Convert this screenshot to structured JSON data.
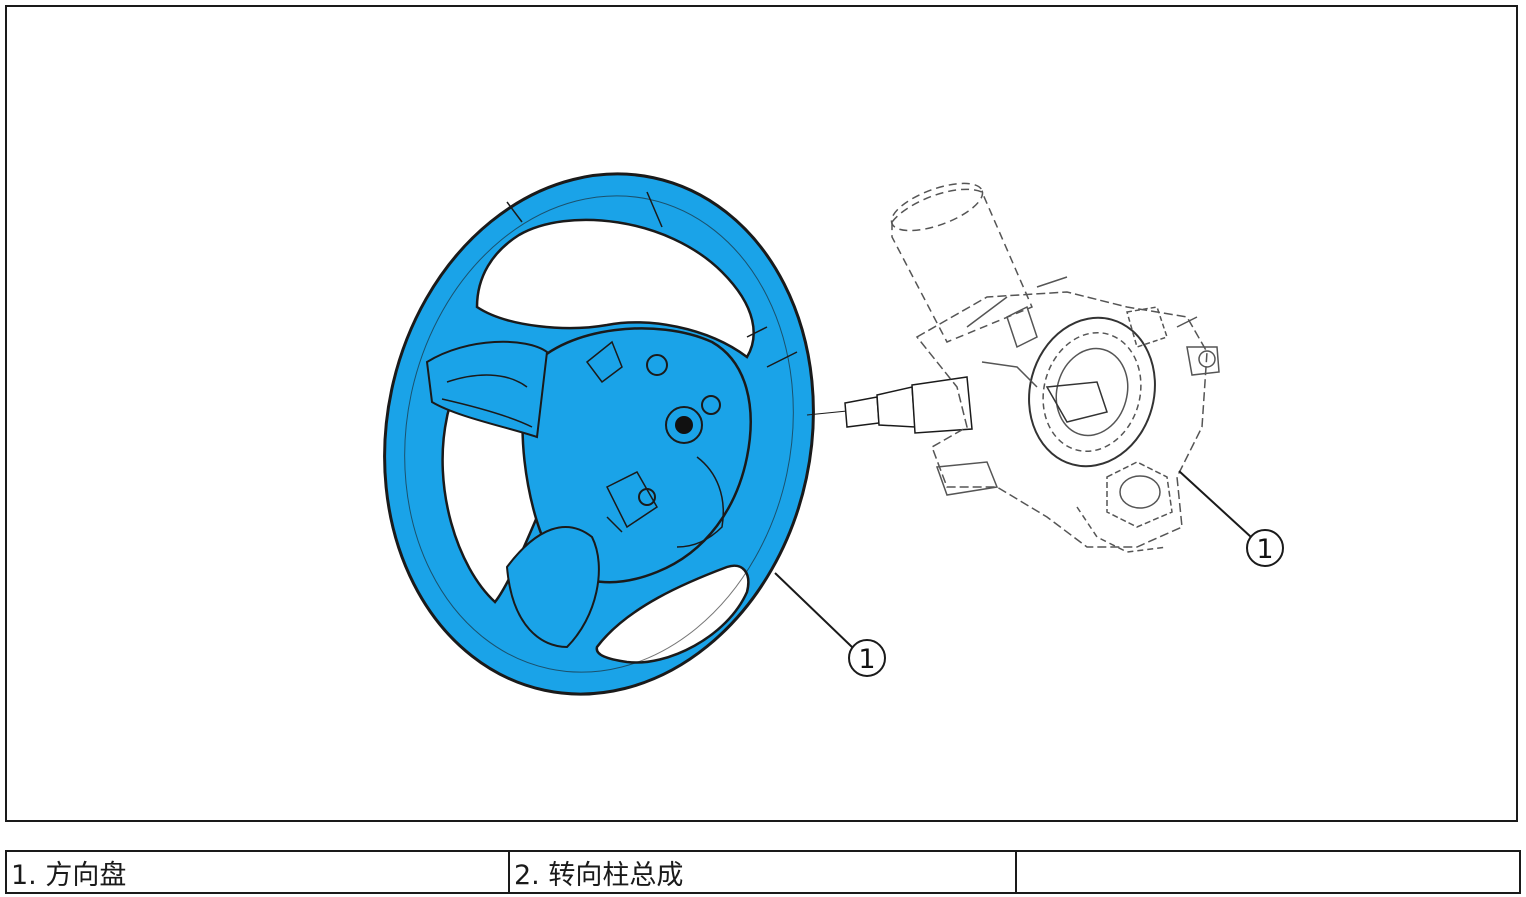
{
  "callouts": [
    {
      "id": "wheel",
      "label": "1"
    },
    {
      "id": "column",
      "label": "1"
    }
  ],
  "legend": [
    {
      "text": "1. 方向盘"
    },
    {
      "text": "2. 转向柱总成"
    },
    {
      "text": ""
    }
  ],
  "colors": {
    "highlight": "#1aa3e8",
    "line": "#1a1a1a",
    "ghost_line": "#555555"
  },
  "icons": {
    "steering_wheel": "steering-wheel-illustration",
    "steering_column": "steering-column-illustration"
  }
}
